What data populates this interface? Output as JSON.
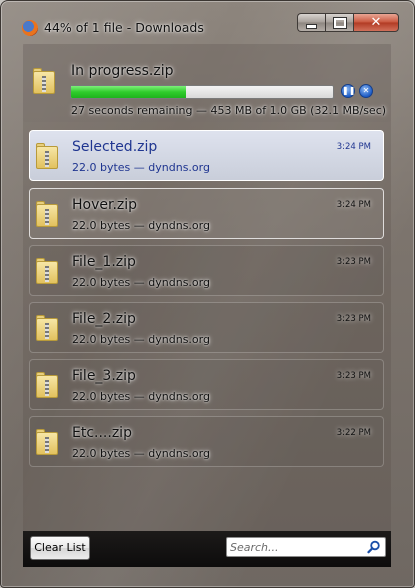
{
  "window": {
    "title": "44% of 1 file - Downloads",
    "caption_buttons": {
      "minimize_icon": "minimize-icon",
      "maximize_icon": "maximize-icon",
      "close_icon": "close-icon",
      "close_glyph": "✕"
    }
  },
  "downloads": {
    "in_progress": {
      "name": "In progress.zip",
      "status": "27 seconds remaining — 453 MB of 1.0 GB (32.1 MB/sec)",
      "progress": 0.44,
      "pause_glyph": "❚❚",
      "cancel_glyph": "✕"
    },
    "items": [
      {
        "name": "Selected.zip",
        "sub": "22.0 bytes — dyndns.org",
        "time": "3:24 PM",
        "state": "selected"
      },
      {
        "name": "Hover.zip",
        "sub": "22.0 bytes — dyndns.org",
        "time": "3:24 PM",
        "state": "hover"
      },
      {
        "name": "File_1.zip",
        "sub": "22.0 bytes — dyndns.org",
        "time": "3:23 PM",
        "state": "normal"
      },
      {
        "name": "File_2.zip",
        "sub": "22.0 bytes — dyndns.org",
        "time": "3:23 PM",
        "state": "normal"
      },
      {
        "name": "File_3.zip",
        "sub": "22.0 bytes — dyndns.org",
        "time": "3:23 PM",
        "state": "normal"
      },
      {
        "name": "Etc....zip",
        "sub": "22.0 bytes — dyndns.org",
        "time": "3:22 PM",
        "state": "normal"
      }
    ]
  },
  "footer": {
    "clear_label": "Clear List",
    "search_placeholder": "Search..."
  },
  "colors": {
    "progress_fill": "#2fcc2c",
    "selected_text": "#1f3590"
  }
}
